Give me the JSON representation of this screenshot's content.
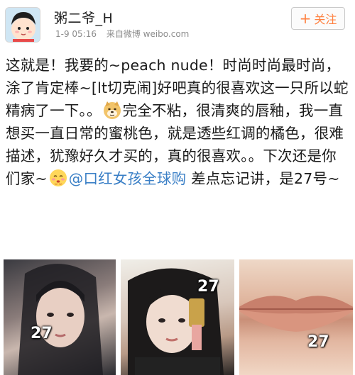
{
  "header": {
    "username": "粥二爷_H",
    "time": "1-9 05:16",
    "source": "来自微博 weibo.com",
    "follow_icon": "plus-icon",
    "follow_label": "关注",
    "accent_color": "#ff8140"
  },
  "post": {
    "text_1": "这就是！我要的~peach nude！时尚时尚最时尚，涂了肯定棒~[lt切克闹]好吧真的很喜欢这一只所以蛇精病了一下。。",
    "emoji_1": "doge-emoji-icon",
    "text_2": "完全不粘，很清爽的唇釉，我一直想买一直日常的蜜桃色，就是透些红调的橘色，很难描述，犹豫好久才买的，真的很喜欢。。下次还是你们家~",
    "emoji_2": "shy-emoji-icon",
    "mention": "@口红女孩全球购",
    "text_3": " 差点忘记讲，是27号~",
    "mention_color": "#3a7fc6"
  },
  "photos": [
    {
      "label": "27"
    },
    {
      "label": "27"
    },
    {
      "label": "27"
    }
  ]
}
